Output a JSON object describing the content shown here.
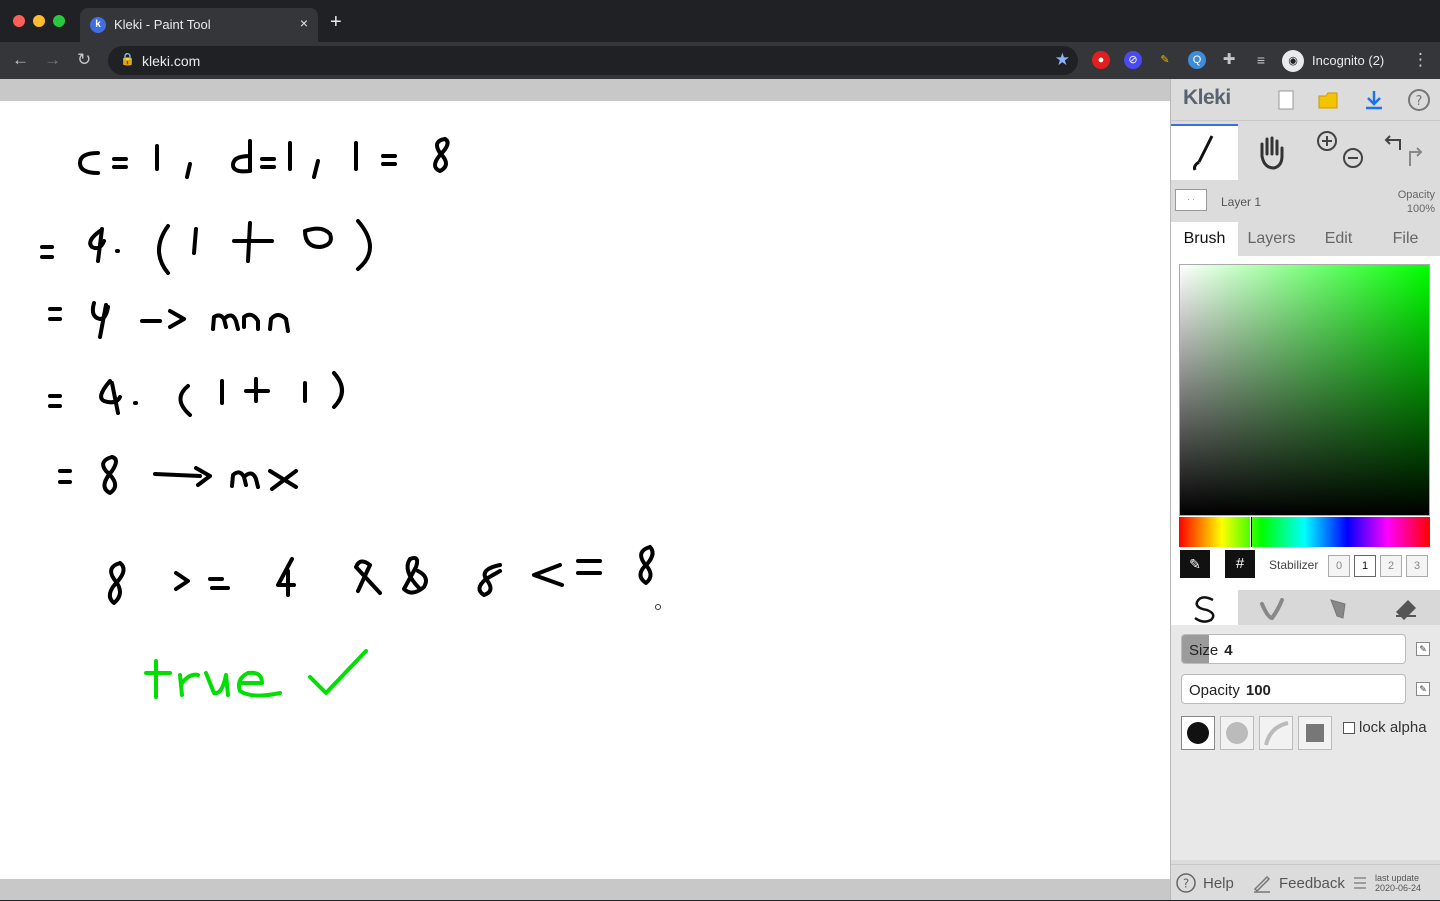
{
  "browser": {
    "tab_title": "Kleki - Paint Tool",
    "url": "kleki.com",
    "incognito_label": "Incognito (2)",
    "new_tab_glyph": "+",
    "close_glyph": "×"
  },
  "app": {
    "logo": "Kleki",
    "layer": {
      "name": "Layer 1",
      "opacity_label": "Opacity",
      "opacity_value": "100%"
    },
    "tabs": [
      "Brush",
      "Layers",
      "Edit",
      "File"
    ],
    "active_tab": "Brush",
    "color": {
      "hue_hex": "#00ff00",
      "hex_button": "#"
    },
    "stabilizer": {
      "label": "Stabilizer",
      "options": [
        "0",
        "1",
        "2",
        "3"
      ],
      "selected": "1"
    },
    "brush": {
      "size_label": "Size",
      "size_value": "4",
      "size_fraction": 0.12,
      "opacity_label": "Opacity",
      "opacity_value": "100",
      "opacity_fraction": 0.0,
      "lock_alpha_label": "lock alpha"
    },
    "footer": {
      "help": "Help",
      "feedback": "Feedback",
      "last_update_label": "last update",
      "last_update_date": "2020-06-24"
    }
  },
  "canvas_note_lines": [
    "c = 1 , d = 1 , l = 8",
    "= 4 · ( 1 + 0 )",
    "= 4 -> mn",
    "= 4 · ( 1 + 1 )",
    "= 8 -> mx",
    "8 >= 4 && 8 <= 8",
    "true ✓"
  ],
  "colors": {
    "accent": "#3c6ee0",
    "ink": "#000000",
    "green_ink": "#00e000"
  }
}
